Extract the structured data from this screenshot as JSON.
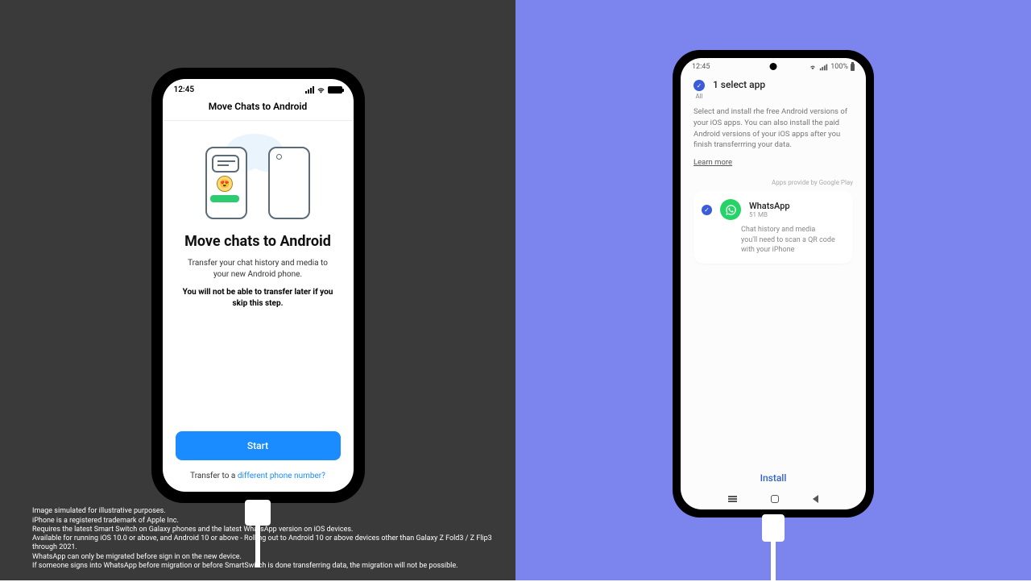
{
  "left": {
    "statusbar_time": "12:45",
    "header_title": "Move Chats to Android",
    "main_title": "Move chats to Android",
    "description": "Transfer your chat history and media to your new Android phone.",
    "warning": "You will not be able to transfer later if you skip this step.",
    "start_label": "Start",
    "transfer_prefix": "Transfer to a ",
    "transfer_link": "different phone number?"
  },
  "right": {
    "statusbar_time": "12:45",
    "statusbar_battery": "100%",
    "select_title": "1 select app",
    "select_all": "All",
    "select_desc": "Select and install rhe free Android versions of your iOS apps. You can also install the paid Android versions of your iOS apps after you finish transferrring your data.",
    "learn_more": "Learn more",
    "provider": "Apps provide by Google Play",
    "app_name": "WhatsApp",
    "app_size": "51 MB",
    "app_sub1": "Chat history and media",
    "app_sub2": "you'll need to scan a QR code with your iPhone",
    "install_label": "Install"
  },
  "disclaimer": [
    "Image simulated for illustrative purposes.",
    "iPhone is a registered trademark of Apple Inc.",
    "Requires the latest Smart Switch on Galaxy phones and the latest WhatsApp version on iOS devices.",
    "Available for running iOS 10.0 or above, and Android 10 or above - Rolling out to Android 10 or above devices other than Galaxy Z Fold3 / Z Flip3 through 2021.",
    "WhatsApp can only be migrated before sign in on the new device.",
    "If someone signs into WhatsApp before migration or before SmartSwitch is done transferring data, the migration will not be possible."
  ]
}
